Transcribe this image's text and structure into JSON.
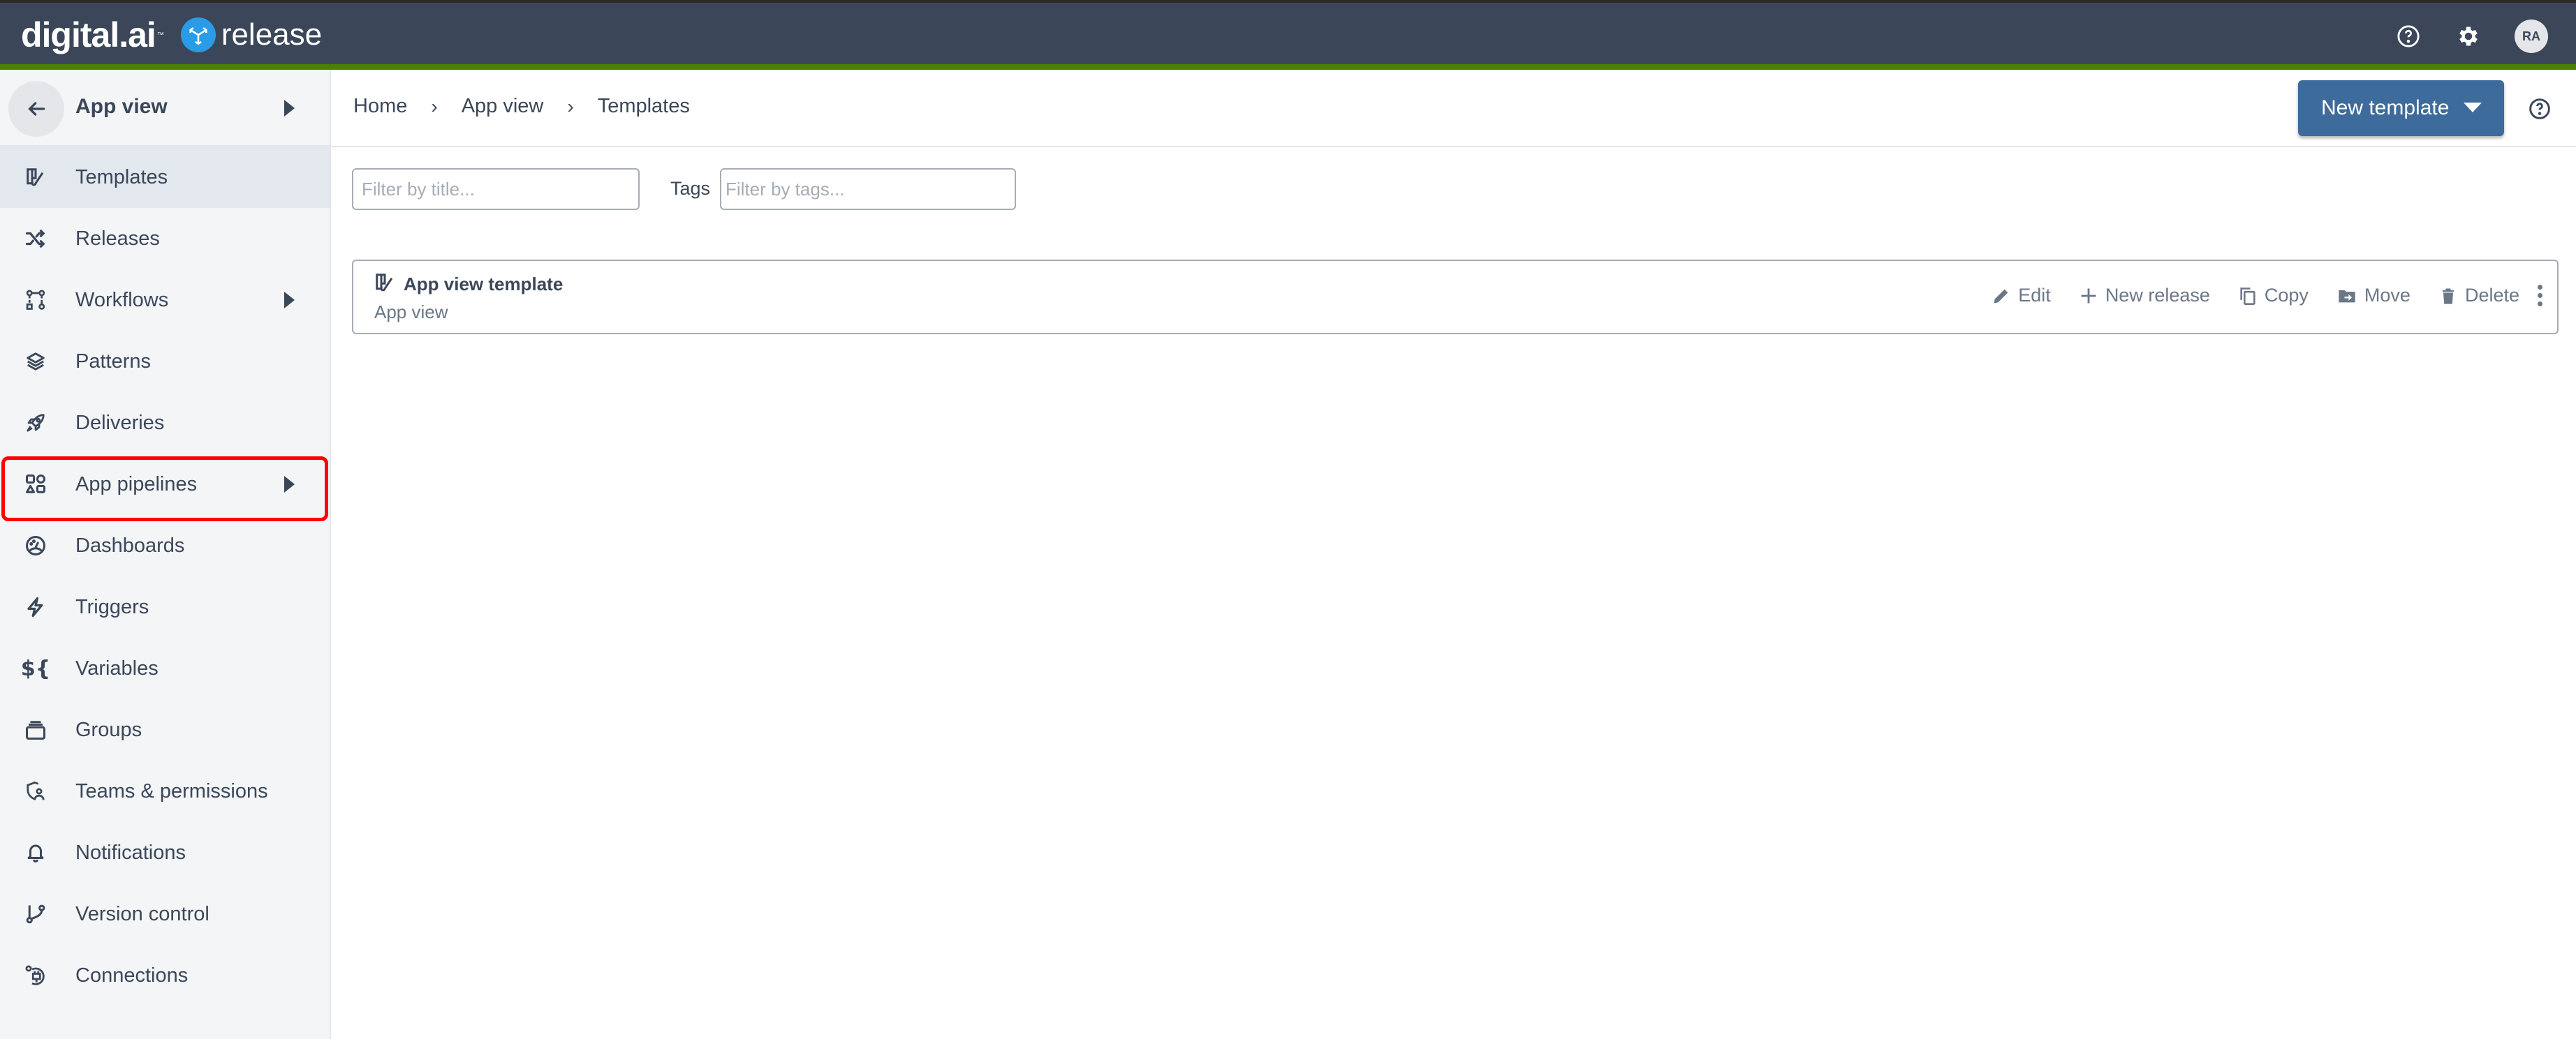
{
  "header": {
    "brand": "digital.ai",
    "product": "release",
    "icons": [
      "help-circle-icon",
      "gear-icon"
    ],
    "user_initials": "RA"
  },
  "sidebar": {
    "context_title": "App view",
    "back_icon": "arrow-left-icon",
    "items": [
      {
        "label": "Templates",
        "icon": "template-icon",
        "active": true,
        "has_submenu": false
      },
      {
        "label": "Releases",
        "icon": "shuffle-icon",
        "active": false,
        "has_submenu": false
      },
      {
        "label": "Workflows",
        "icon": "workflow-icon",
        "active": false,
        "has_submenu": true
      },
      {
        "label": "Patterns",
        "icon": "layers-icon",
        "active": false,
        "has_submenu": false
      },
      {
        "label": "Deliveries",
        "icon": "rocket-icon",
        "active": false,
        "has_submenu": false
      },
      {
        "label": "App pipelines",
        "icon": "shapes-icon",
        "active": false,
        "has_submenu": true,
        "highlighted": true
      },
      {
        "label": "Dashboards",
        "icon": "gauge-icon",
        "active": false,
        "has_submenu": false
      },
      {
        "label": "Triggers",
        "icon": "lightning-icon",
        "active": false,
        "has_submenu": false
      },
      {
        "label": "Variables",
        "icon": "variable-icon",
        "active": false,
        "has_submenu": false
      },
      {
        "label": "Groups",
        "icon": "stack-icon",
        "active": false,
        "has_submenu": false
      },
      {
        "label": "Teams & permissions",
        "icon": "shield-user-icon",
        "active": false,
        "has_submenu": false
      },
      {
        "label": "Notifications",
        "icon": "bell-icon",
        "active": false,
        "has_submenu": false
      },
      {
        "label": "Version control",
        "icon": "git-branch-icon",
        "active": false,
        "has_submenu": false
      },
      {
        "label": "Connections",
        "icon": "plug-icon",
        "active": false,
        "has_submenu": false
      }
    ]
  },
  "breadcrumb": [
    "Home",
    "App view",
    "Templates"
  ],
  "toolbar": {
    "new_template_label": "New template"
  },
  "filters": {
    "title_placeholder": "Filter by title...",
    "title_value": "",
    "tags_label": "Tags",
    "tags_placeholder": "Filter by tags...",
    "tags_value": ""
  },
  "templates": [
    {
      "title": "App view template",
      "folder": "App view",
      "actions": [
        "Edit",
        "New release",
        "Copy",
        "Move",
        "Delete"
      ]
    }
  ],
  "colors": {
    "header_bg": "#3b4759",
    "accent_green": "#4a8200",
    "primary_button": "#3d6b9c",
    "highlight_border": "#ff0000"
  }
}
